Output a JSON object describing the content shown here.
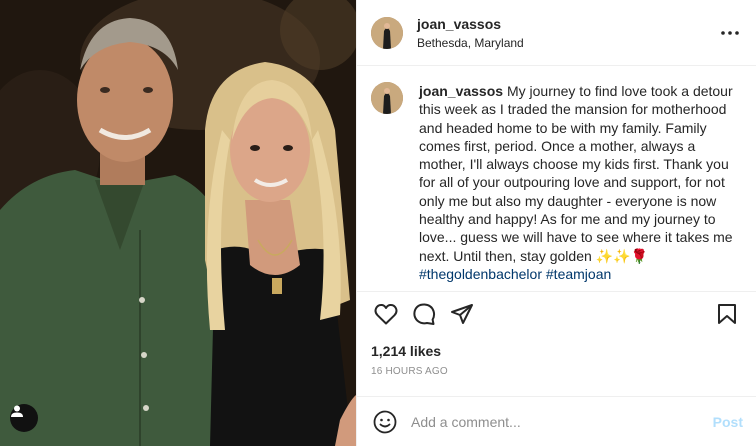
{
  "post": {
    "username": "joan_vassos",
    "location": "Bethesda, Maryland",
    "caption_text": "My journey to find love took a detour this week as I traded the mansion for motherhood and headed home to be with my family. Family comes first, period. Once a mother, always a mother, I'll always choose my kids first. Thank you for all of your outpouring love and support, for not only me but also my daughter - everyone is now healthy and happy! As for me and my journey to love... guess we will have to see where it takes me next. Until then, stay golden ✨✨🌹",
    "hashtags": [
      "#thegoldenbachelor",
      "#teamjoan"
    ],
    "likes": "1,214 likes",
    "time": "16 HOURS AGO"
  },
  "comment": {
    "placeholder": "Add a comment...",
    "post_label": "Post"
  },
  "icons": {
    "more": "more-horizontal-icon",
    "like": "heart-icon",
    "comment": "comment-icon",
    "share": "send-icon",
    "save": "bookmark-icon",
    "emoji": "emoji-icon",
    "tag": "user-tag-icon"
  },
  "colors": {
    "text": "#262626",
    "muted": "#8e8e8e",
    "hashtag": "#00376b",
    "post_disabled": "#b2dffc",
    "border": "#efefef"
  }
}
